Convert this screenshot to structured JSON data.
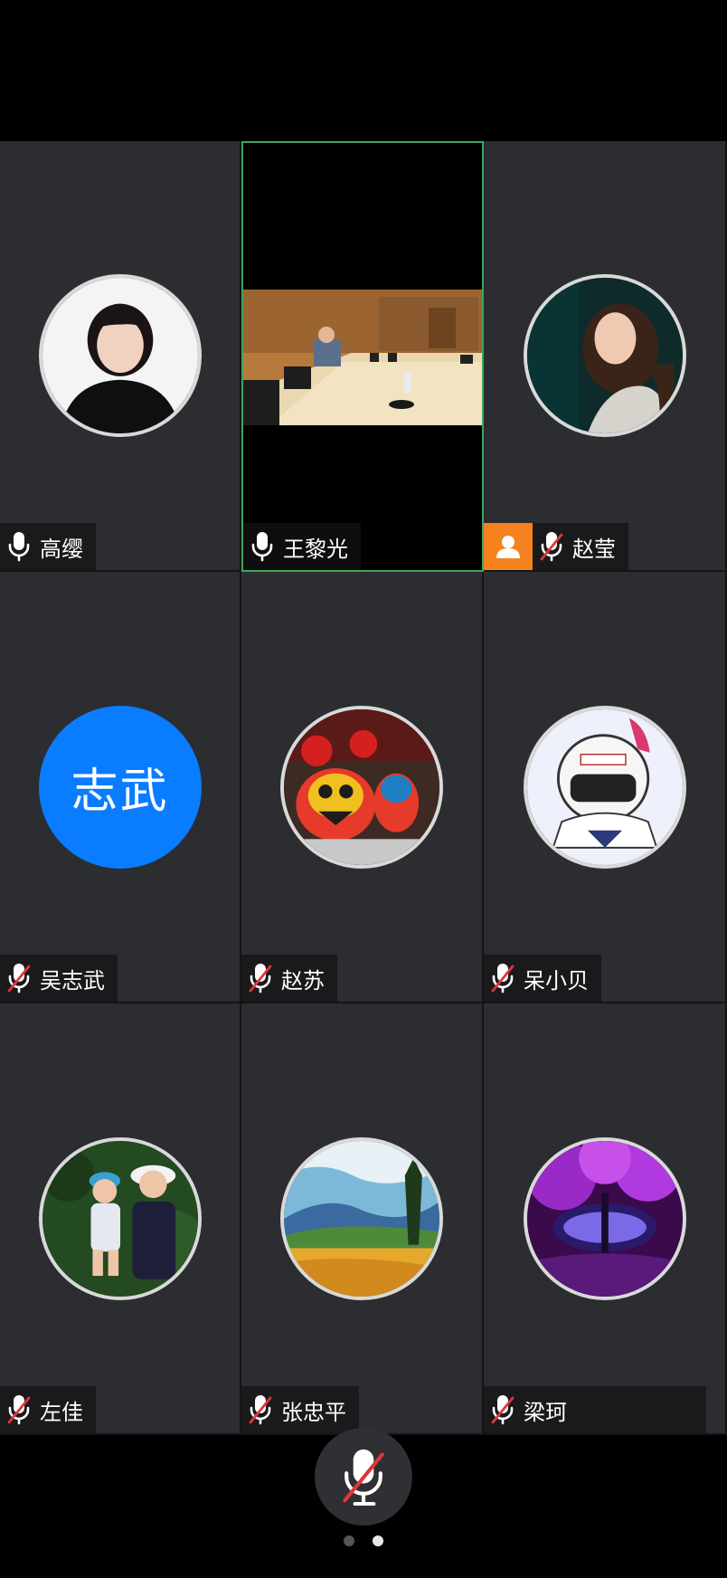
{
  "participants": [
    {
      "name": "高缨",
      "muted": false,
      "role": "participant"
    },
    {
      "name": "王黎光",
      "muted": false,
      "role": "speaker",
      "video": true
    },
    {
      "name": "赵莹",
      "muted": true,
      "role": "host"
    },
    {
      "name": "吴志武",
      "muted": true,
      "initials": "志武",
      "avatar_color": "#0a7cff"
    },
    {
      "name": "赵苏",
      "muted": true
    },
    {
      "name": "呆小贝",
      "muted": true
    },
    {
      "name": "左佳",
      "muted": true
    },
    {
      "name": "张忠平",
      "muted": true
    },
    {
      "name": "梁珂",
      "muted": true
    }
  ],
  "controls": {
    "mute_button_icon": "mic-muted-icon"
  },
  "pagination": {
    "pages": 2,
    "current": 2
  },
  "colors": {
    "active_speaker_border": "#3ea65a",
    "host_badge": "#f5821f",
    "tile_bg": "#2b2d31",
    "muted_slash": "#e0363a"
  }
}
